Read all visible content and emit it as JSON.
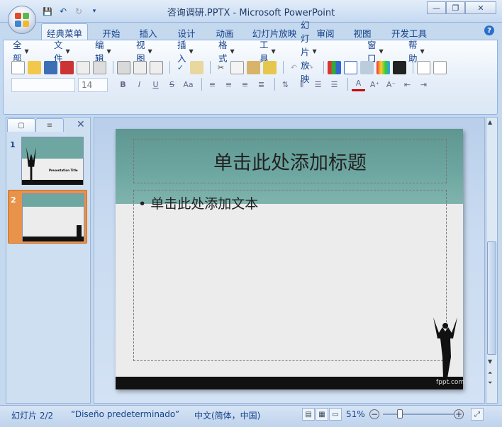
{
  "window": {
    "title": "咨询调研.PPTX - Microsoft PowerPoint",
    "minimize": "—",
    "restore": "❐",
    "close": "✕"
  },
  "qat": {
    "save_icon": "💾",
    "undo_icon": "↶",
    "redo_icon": "↻",
    "customize_icon": "▾"
  },
  "tabs": [
    {
      "label": "经典菜单",
      "active": true
    },
    {
      "label": "开始"
    },
    {
      "label": "插入"
    },
    {
      "label": "设计"
    },
    {
      "label": "动画"
    },
    {
      "label": "幻灯片放映"
    },
    {
      "label": "审阅"
    },
    {
      "label": "视图"
    },
    {
      "label": "开发工具"
    }
  ],
  "menus": [
    "全部",
    "文件",
    "编辑",
    "视图",
    "插入",
    "格式",
    "工具",
    "幻灯片放映",
    "窗口",
    "帮助"
  ],
  "format_bar": {
    "font_name": "",
    "font_size": "14"
  },
  "slides_pane": {
    "slide_numbers": [
      "1",
      "2"
    ],
    "thumb1_title": "Presentation Title"
  },
  "slide": {
    "title_placeholder": "单击此处添加标题",
    "bullet": "•",
    "body_placeholder": "单击此处添加文本",
    "footer_brand": "fppt.com"
  },
  "status": {
    "slide_indicator": "幻灯片 2/2",
    "theme": "“Diseño predeterminado”",
    "language": "中文(简体，中国)",
    "zoom": "51%"
  },
  "colors": {
    "accent": "#15428b",
    "slide_header": "#6ea7a1",
    "selected_thumb": "#e9924a"
  }
}
